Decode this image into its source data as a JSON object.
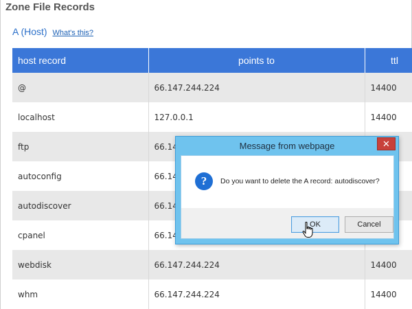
{
  "page": {
    "title": "Zone File Records",
    "section_label": "A (Host)",
    "help_link": "What's this?"
  },
  "table": {
    "headers": [
      "host record",
      "points to",
      "ttl"
    ],
    "rows": [
      {
        "host": "@",
        "points_to": "66.147.244.224",
        "ttl": "14400"
      },
      {
        "host": "localhost",
        "points_to": "127.0.0.1",
        "ttl": "14400"
      },
      {
        "host": "ftp",
        "points_to": "66.14",
        "ttl": ""
      },
      {
        "host": "autoconfig",
        "points_to": "66.14",
        "ttl": ""
      },
      {
        "host": "autodiscover",
        "points_to": "66.14",
        "ttl": ""
      },
      {
        "host": "cpanel",
        "points_to": "66.14",
        "ttl": ""
      },
      {
        "host": "webdisk",
        "points_to": "66.147.244.224",
        "ttl": "14400"
      },
      {
        "host": "whm",
        "points_to": "66.147.244.224",
        "ttl": "14400"
      }
    ]
  },
  "dialog": {
    "title": "Message from webpage",
    "close_glyph": "✕",
    "icon_glyph": "?",
    "message": "Do you want to delete the A record: autodiscover?",
    "ok_label": "OK",
    "cancel_label": "Cancel"
  },
  "icons": {
    "question": "question-icon",
    "close": "close-icon",
    "cursor": "hand-pointer-icon"
  },
  "colors": {
    "header_bg": "#3b77d8",
    "row_alt": "#e8e8e8",
    "dialog_frame": "#6fc3ee",
    "close_bg": "#c8413b",
    "icon_blue": "#1f6fd4"
  }
}
